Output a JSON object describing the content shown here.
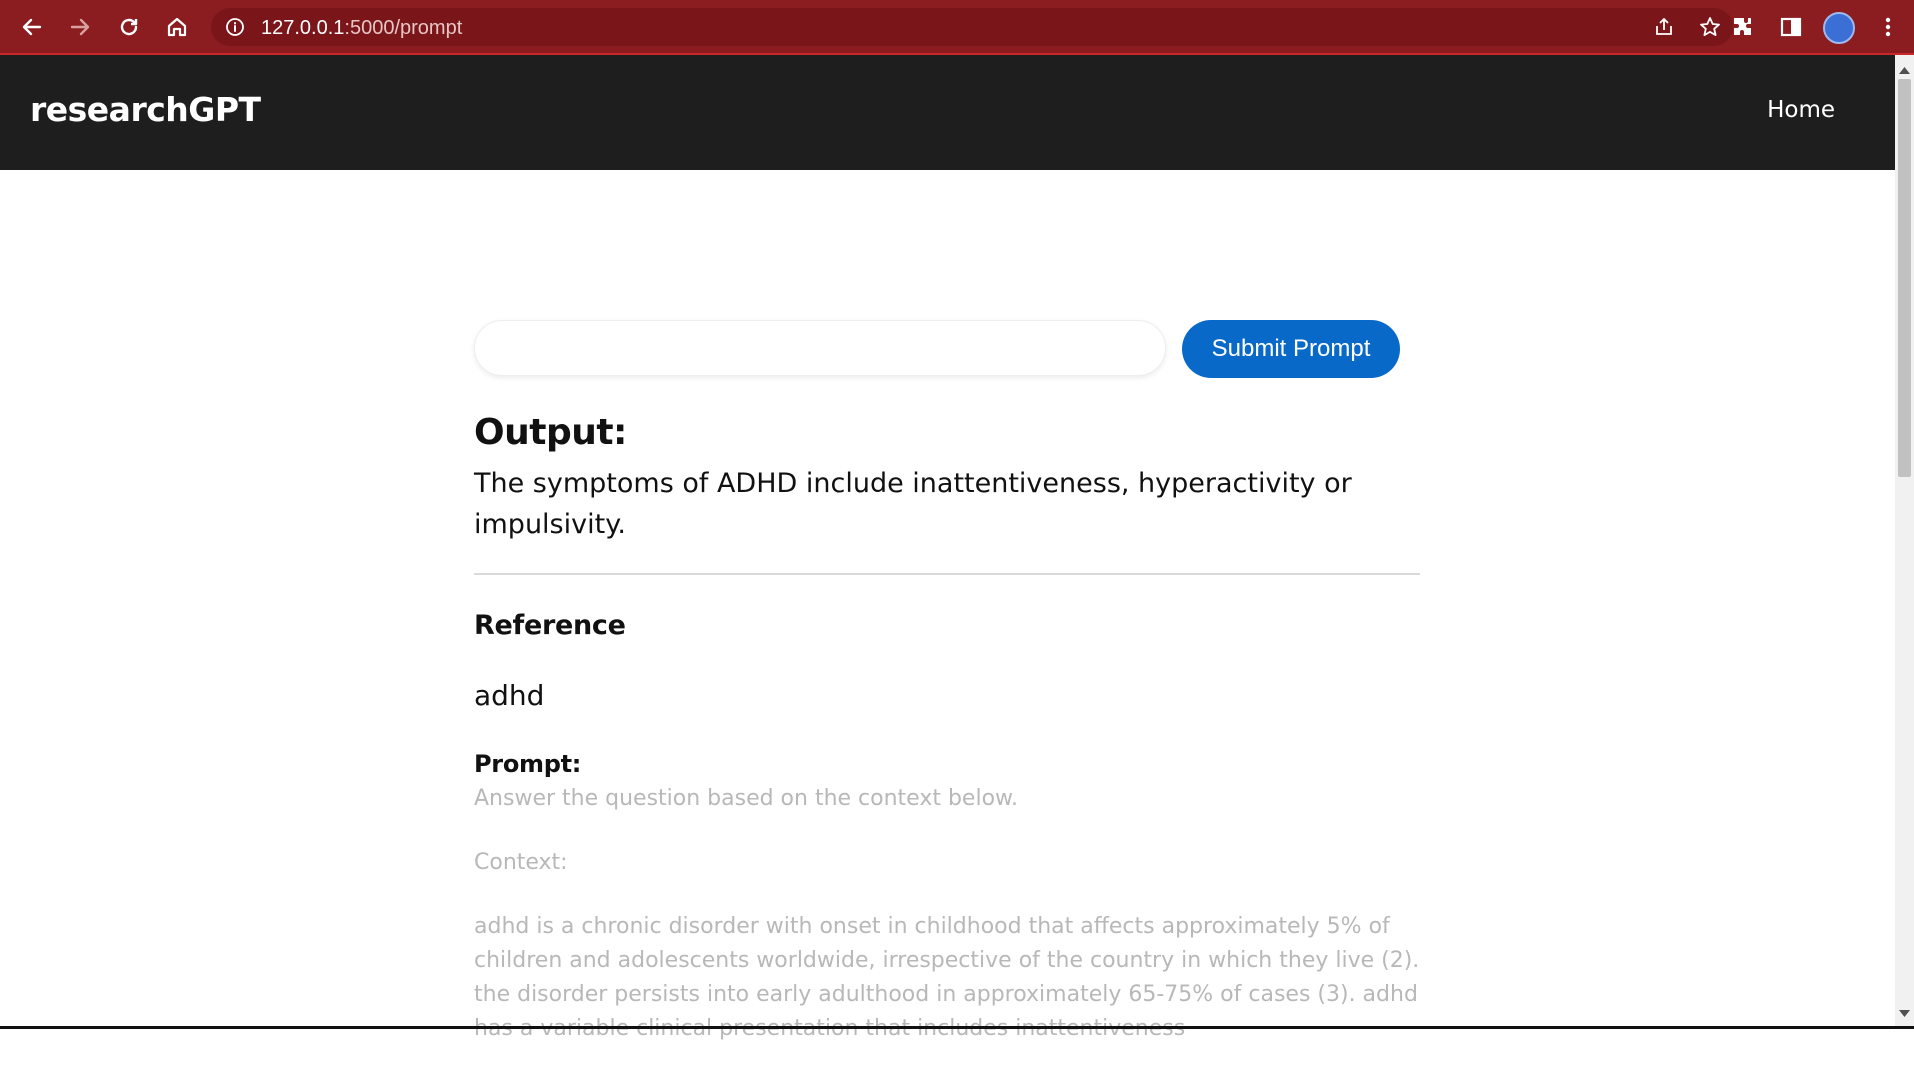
{
  "browser": {
    "url_host": "127.0.0.1",
    "url_path": ":5000/prompt",
    "icons": [
      "back-icon",
      "forward-icon",
      "reload-icon",
      "home-icon",
      "info-icon",
      "share-icon",
      "star-icon",
      "extensions-icon",
      "sidepanel-icon",
      "profile-avatar",
      "menu-icon"
    ],
    "colors": {
      "frame": "#8b1c1f",
      "omnibox": "#7a1519"
    }
  },
  "nav": {
    "brand": "researchGPT",
    "home_label": "Home"
  },
  "prompt_form": {
    "input_value": "",
    "submit_label": "Submit Prompt"
  },
  "output": {
    "heading": "Output:",
    "text": "The symptoms of ADHD include inattentiveness, hyperactivity or impulsivity."
  },
  "reference": {
    "heading": "Reference",
    "value": "adhd"
  },
  "prompt_section": {
    "heading": "Prompt:",
    "instruction": "Answer the question based on the context below.",
    "context_label": "Context:",
    "context_text": "adhd is a chronic disorder with onset in childhood that affects approximately 5% of children and adolescents worldwide, irrespective of the country in which they live (2). the disorder persists into early adulthood in approximately 65-75% of cases (3). adhd has a variable clinical presentation that includes inattentiveness"
  },
  "colors": {
    "nav_bg": "#1e1e1e",
    "accent": "#0969c9",
    "muted_text": "#b8b8b8"
  }
}
